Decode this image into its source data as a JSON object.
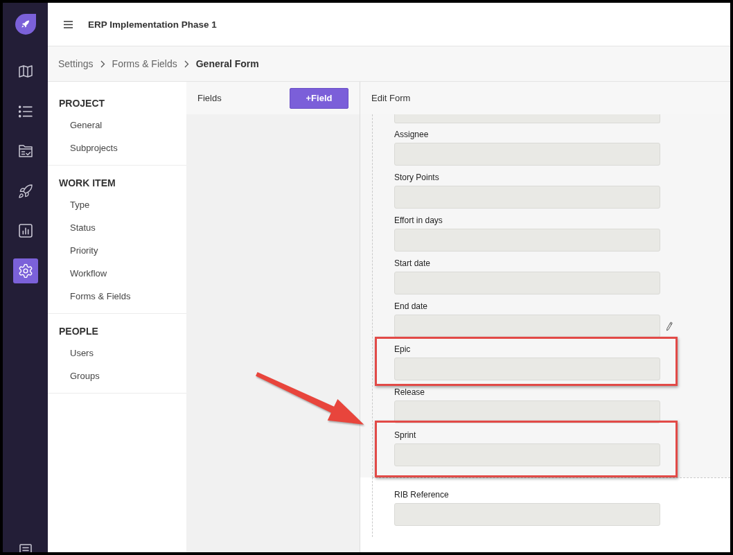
{
  "rail": {
    "items": [
      {
        "kind": "map",
        "selected": false
      },
      {
        "kind": "list",
        "selected": false
      },
      {
        "kind": "folder",
        "selected": false
      },
      {
        "kind": "rocket",
        "selected": false
      },
      {
        "kind": "chart",
        "selected": false
      },
      {
        "kind": "gear",
        "selected": true
      }
    ],
    "footer_items": [
      {
        "kind": "notes",
        "selected": false
      }
    ]
  },
  "header": {
    "title": "ERP Implementation Phase 1"
  },
  "breadcrumb": [
    {
      "label": "Settings",
      "current": false
    },
    {
      "label": "Forms & Fields",
      "current": false
    },
    {
      "label": "General Form",
      "current": true
    }
  ],
  "settings_nav": {
    "sections": [
      {
        "heading": "PROJECT",
        "items": [
          {
            "label": "General",
            "selected": false
          },
          {
            "label": "Subprojects",
            "selected": false
          }
        ]
      },
      {
        "heading": "WORK ITEM",
        "items": [
          {
            "label": "Type",
            "selected": false
          },
          {
            "label": "Status",
            "selected": false
          },
          {
            "label": "Priority",
            "selected": false
          },
          {
            "label": "Workflow",
            "selected": false
          },
          {
            "label": "Forms & Fields",
            "selected": false
          }
        ]
      },
      {
        "heading": "PEOPLE",
        "items": [
          {
            "label": "Users",
            "selected": false
          },
          {
            "label": "Groups",
            "selected": false
          }
        ]
      }
    ]
  },
  "fields_panel": {
    "title": "Fields",
    "add_button": "+Field"
  },
  "edit_form": {
    "title": "Edit Form",
    "field_group": {
      "cut_off_field_above": true,
      "fields": [
        {
          "label": "Assignee",
          "edit_icon": false,
          "highlighted": false,
          "arrow": false
        },
        {
          "label": "Story Points",
          "edit_icon": false,
          "highlighted": false,
          "arrow": false
        },
        {
          "label": "Effort in days",
          "edit_icon": false,
          "highlighted": false,
          "arrow": false
        },
        {
          "label": "Start date",
          "edit_icon": false,
          "highlighted": false,
          "arrow": false
        },
        {
          "label": "End date",
          "edit_icon": true,
          "highlighted": false,
          "arrow": false
        },
        {
          "label": "Epic",
          "edit_icon": false,
          "highlighted": true,
          "arrow": false
        },
        {
          "label": "Release",
          "edit_icon": false,
          "highlighted": false,
          "arrow": true
        },
        {
          "label": "Sprint",
          "edit_icon": false,
          "highlighted": true,
          "arrow": false
        }
      ]
    },
    "fields_below": [
      {
        "label": "RIB Reference",
        "edit_icon": false,
        "highlighted": false,
        "arrow": false
      }
    ]
  }
}
